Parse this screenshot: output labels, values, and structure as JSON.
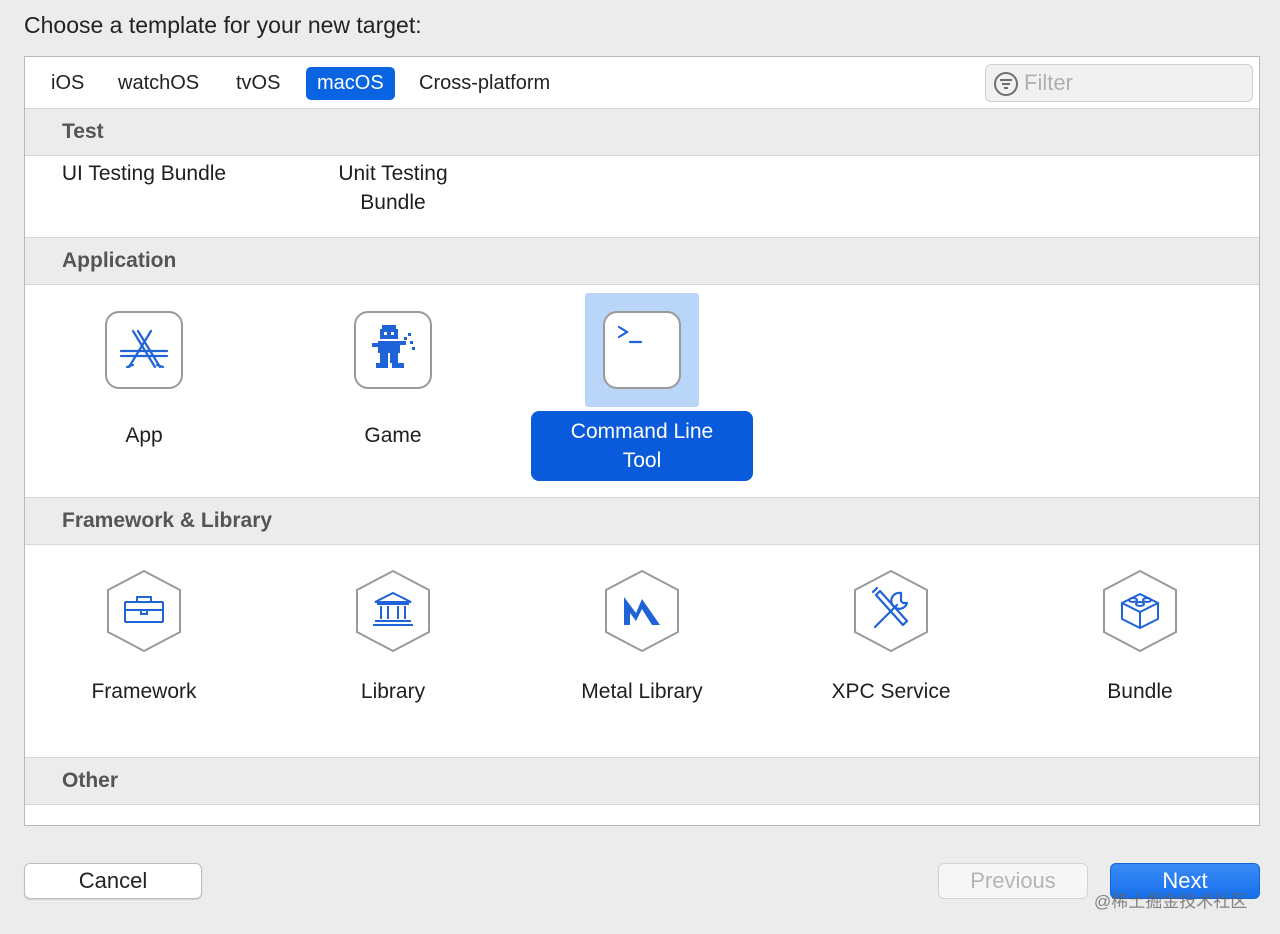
{
  "prompt": "Choose a template for your new target:",
  "tabs": [
    {
      "label": "iOS",
      "selected": false
    },
    {
      "label": "watchOS",
      "selected": false
    },
    {
      "label": "tvOS",
      "selected": false
    },
    {
      "label": "macOS",
      "selected": true
    },
    {
      "label": "Cross-platform",
      "selected": false
    }
  ],
  "filter": {
    "placeholder": "Filter",
    "value": ""
  },
  "sections": [
    {
      "title": "Test",
      "items": [
        {
          "label": "UI Testing Bundle",
          "icon": "none"
        },
        {
          "label": "Unit Testing Bundle",
          "icon": "none"
        }
      ]
    },
    {
      "title": "Application",
      "items": [
        {
          "label": "App",
          "icon": "app-store-icon"
        },
        {
          "label": "Game",
          "icon": "game-robot-icon"
        },
        {
          "label": "Command Line Tool",
          "icon": "terminal-icon",
          "selected": true
        }
      ]
    },
    {
      "title": "Framework & Library",
      "items": [
        {
          "label": "Framework",
          "icon": "toolbox-icon"
        },
        {
          "label": "Library",
          "icon": "building-icon"
        },
        {
          "label": "Metal Library",
          "icon": "metal-icon"
        },
        {
          "label": "XPC Service",
          "icon": "wrench-screwdriver-icon"
        },
        {
          "label": "Bundle",
          "icon": "lego-brick-icon"
        }
      ]
    },
    {
      "title": "Other",
      "items": []
    }
  ],
  "buttons": {
    "cancel": "Cancel",
    "previous": "Previous",
    "next": "Next"
  },
  "watermark": "@稀土掘金技术社区",
  "colors": {
    "accent": "#0a63e0",
    "selection_highlight": "#b9d6f8",
    "icon_blue": "#1f63d8",
    "section_bg": "#ececec"
  }
}
